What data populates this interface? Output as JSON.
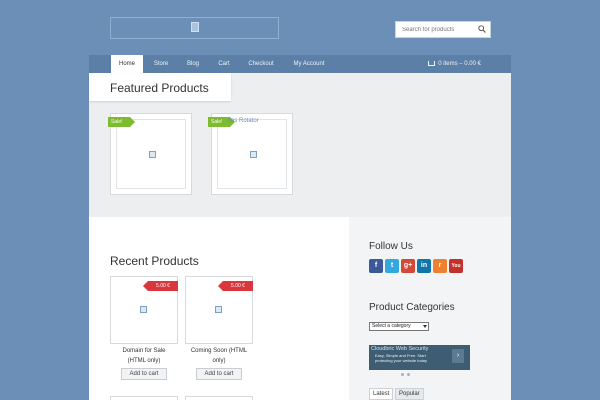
{
  "search": {
    "placeholder": "Search for products"
  },
  "nav": {
    "items": [
      {
        "label": "Home",
        "active": true
      },
      {
        "label": "Store"
      },
      {
        "label": "Blog"
      },
      {
        "label": "Cart"
      },
      {
        "label": "Checkout"
      },
      {
        "label": "My Account"
      }
    ],
    "cart_summary": "0 items – 0.00 €"
  },
  "featured": {
    "title": "Featured Products",
    "products": [
      {
        "badge": "Sale!",
        "title": ""
      },
      {
        "badge": "Sale!",
        "title": "ites Rotator"
      }
    ]
  },
  "recent": {
    "title": "Recent Products",
    "products": [
      {
        "price": "5.00 €",
        "name_line1": "Domain for Sale",
        "name_line2": "(HTML only)",
        "button": "Add to cart"
      },
      {
        "price": "5.00 €",
        "name_line1": "Coming Soon (HTML",
        "name_line2": "only)",
        "button": "Add to cart"
      }
    ]
  },
  "sidebar": {
    "follow_title": "Follow Us",
    "social": [
      {
        "name": "facebook-icon",
        "glyph": "f",
        "color": "#3b5998"
      },
      {
        "name": "twitter-icon",
        "glyph": "t",
        "color": "#33a8e0"
      },
      {
        "name": "google-plus-icon",
        "glyph": "g+",
        "color": "#d34836"
      },
      {
        "name": "linkedin-icon",
        "glyph": "in",
        "color": "#0e76a8"
      },
      {
        "name": "rss-icon",
        "glyph": "r",
        "color": "#ee802f"
      },
      {
        "name": "youtube-icon",
        "glyph": "You",
        "color": "#c4302b"
      }
    ],
    "categories_title": "Product Categories",
    "category_select": "Select a category",
    "ad": {
      "title": "Cloudbric Web Security",
      "line1": "Easy, Simple and Free. Start",
      "line2": "protecting your website today"
    },
    "tabs": [
      "Latest",
      "Popular"
    ]
  },
  "colors": {
    "background": "#6b8fb6",
    "nav": "#5b7fa6",
    "sale": "#7dbb2f",
    "price": "#d9363e"
  }
}
